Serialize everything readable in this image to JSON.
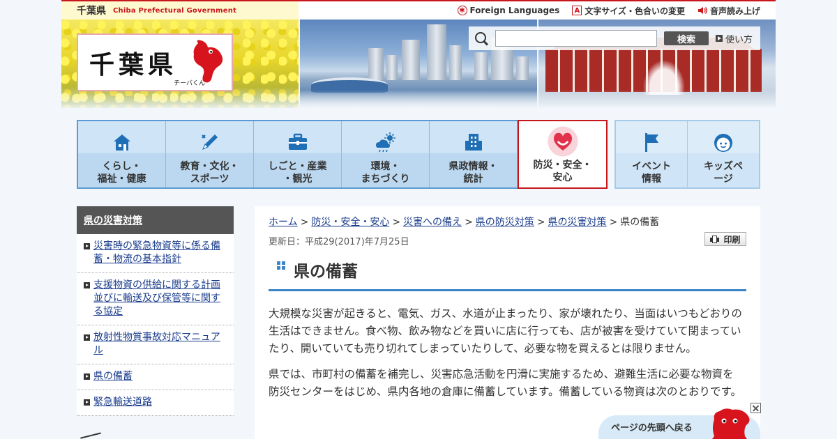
{
  "header": {
    "brand_small": "千葉県",
    "brand_en": "Chiba Prefectural Government",
    "logo_text": "千葉県",
    "mascot_name": "チーバくん",
    "util_links": [
      {
        "label": "Foreign Languages",
        "icon": "globe-icon"
      },
      {
        "label": "文字サイズ・色合いの変更",
        "icon": "text-size-icon"
      },
      {
        "label": "音声読み上げ",
        "icon": "speaker-icon"
      }
    ],
    "search": {
      "placeholder": "",
      "button_label": "検索",
      "help_label": "使い方"
    }
  },
  "nav": {
    "items": [
      {
        "label": "くらし・\n福祉・健康",
        "icon": "house-icon"
      },
      {
        "label": "教育・文化・\nスポーツ",
        "icon": "pencil-icon"
      },
      {
        "label": "しごと・産業\n・観光",
        "icon": "briefcase-icon"
      },
      {
        "label": "環境・\nまちづくり",
        "icon": "weather-icon"
      },
      {
        "label": "県政情報・\n統計",
        "icon": "building-icon"
      },
      {
        "label": "防災・安全・\n安心",
        "icon": "heart-icon"
      }
    ],
    "extra": [
      {
        "label": "イベント\n情報",
        "icon": "flag-icon"
      },
      {
        "label": "キッズペ\nージ",
        "icon": "kids-face-icon"
      }
    ]
  },
  "sidebar": {
    "heading": "県の災害対策",
    "items": [
      "災害時の緊急物資等に係る備蓄・物流の基本指針",
      "支援物資の供給に関する計画並びに輸送及び保管等に関する協定",
      "放射性物質事故対応マニュアル",
      "県の備蓄",
      "緊急輸送道路"
    ]
  },
  "main": {
    "breadcrumb": [
      "ホーム",
      "防災・安全・安心",
      "災害への備え",
      "県の防災対策",
      "県の災害対策"
    ],
    "breadcrumb_current": "県の備蓄",
    "updated": "更新日：平成29(2017)年7月25日",
    "print_label": "印刷",
    "title": "県の備蓄",
    "paragraphs": [
      "大規模な災害が起きると、電気、ガス、水道が止まったり、家が壊れたり、当面はいつもどおりの生活はできません。食べ物、飲み物などを買いに店に行っても、店が被害を受けていて閉まっていたり、開いていても売り切れてしまっていたりして、必要な物を買えるとは限りません。",
      "県では、市町村の備蓄を補完し、災害応急活動を円滑に実施するため、避難生活に必要な物資を防災センターをはじめ、県内各地の倉庫に備蓄しています。備蓄している物資は次のとおりです。"
    ]
  },
  "totop": {
    "label": "ページの先頭へ戻る"
  },
  "colors": {
    "accent_red": "#c8161d",
    "nav_blue": "#5b9bd3",
    "link": "#1a3c8c",
    "title_rule": "#3a84c7"
  }
}
